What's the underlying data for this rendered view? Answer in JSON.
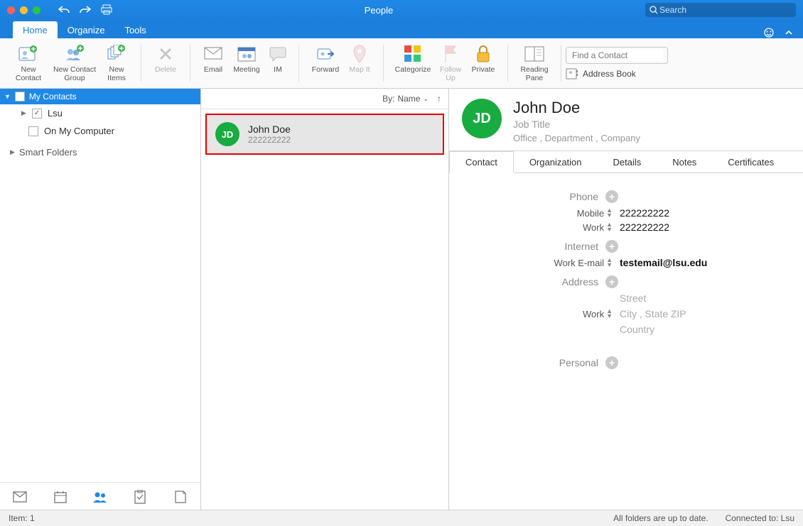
{
  "window": {
    "title": "People"
  },
  "search": {
    "placeholder": "Search"
  },
  "tabs": {
    "home": "Home",
    "organize": "Organize",
    "tools": "Tools"
  },
  "ribbon": {
    "new_contact": "New\nContact",
    "new_contact_group": "New Contact\nGroup",
    "new_items": "New\nItems",
    "delete": "Delete",
    "email": "Email",
    "meeting": "Meeting",
    "im": "IM",
    "forward": "Forward",
    "map_it": "Map It",
    "categorize": "Categorize",
    "follow_up": "Follow\nUp",
    "private": "Private",
    "reading_pane": "Reading\nPane",
    "find_placeholder": "Find a Contact",
    "address_book": "Address Book"
  },
  "sidebar": {
    "my_contacts": "My Contacts",
    "lsu": "Lsu",
    "on_my_computer": "On My Computer",
    "smart_folders": "Smart Folders"
  },
  "list": {
    "sort_by": "By:",
    "sort_field": "Name",
    "contact_name": "John Doe",
    "contact_sub": "222222222",
    "initials": "JD"
  },
  "detail": {
    "initials": "JD",
    "name": "John Doe",
    "job_title": "Job Title",
    "office": "Office",
    "department": "Department",
    "company": "Company",
    "tabs": {
      "contact": "Contact",
      "organization": "Organization",
      "details": "Details",
      "notes": "Notes",
      "certificates": "Certificates"
    },
    "sections": {
      "phone": "Phone",
      "internet": "Internet",
      "address": "Address",
      "personal": "Personal"
    },
    "phone_mobile_label": "Mobile",
    "phone_mobile_value": "222222222",
    "phone_work_label": "Work",
    "phone_work_value": "222222222",
    "email_label": "Work E-mail",
    "email_value": "testemail@lsu.edu",
    "addr_label": "Work",
    "addr_street": "Street",
    "addr_city": "City",
    "addr_state": "State",
    "addr_zip": "ZIP",
    "addr_country": "Country"
  },
  "status": {
    "item_count": "Item: 1",
    "sync": "All folders are up to date.",
    "connected": "Connected to: Lsu"
  }
}
